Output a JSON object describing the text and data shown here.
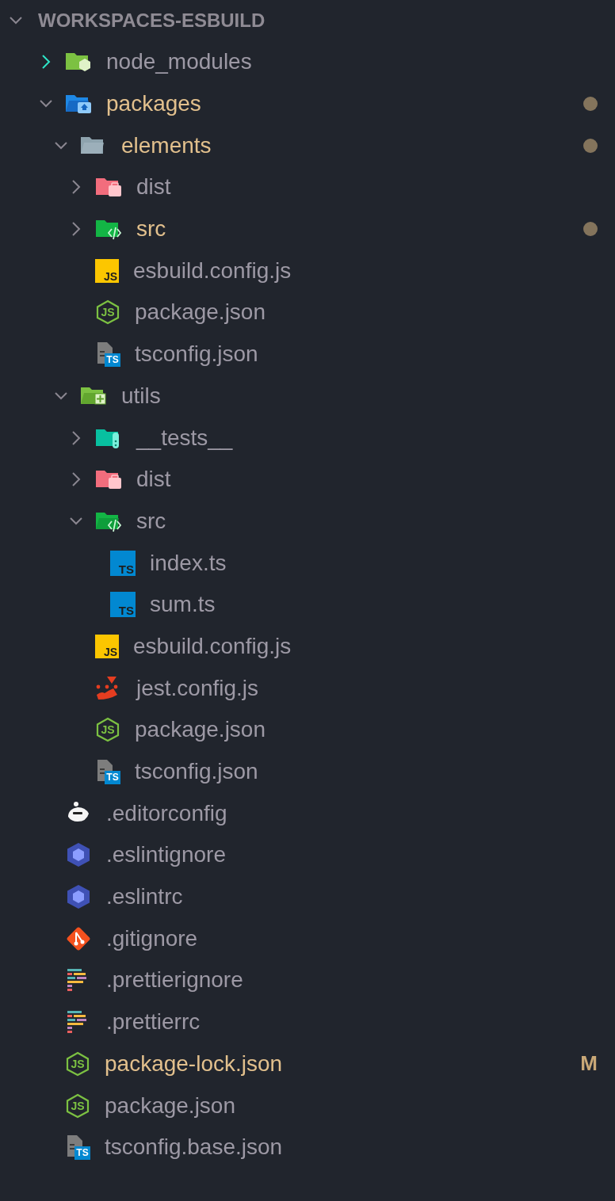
{
  "explorer": {
    "title": "WORKSPACES-ESBUILD",
    "expanded": true,
    "items": [
      {
        "name": "node_modules",
        "kind": "folder-node",
        "expanded": false,
        "selected": true,
        "modified": false,
        "dot": false
      },
      {
        "name": "packages",
        "kind": "folder-packages",
        "expanded": true,
        "selected": false,
        "modified": true,
        "dot": true,
        "children": [
          {
            "name": "elements",
            "kind": "folder-plain",
            "expanded": true,
            "selected": false,
            "modified": true,
            "dot": true,
            "children": [
              {
                "name": "dist",
                "kind": "folder-dist",
                "expanded": false,
                "selected": false,
                "modified": false,
                "dot": false
              },
              {
                "name": "src",
                "kind": "folder-src",
                "expanded": false,
                "selected": false,
                "modified": true,
                "dot": true
              },
              {
                "name": "esbuild.config.js",
                "kind": "js-file",
                "icon_label": "JS",
                "modified": false,
                "dot": false
              },
              {
                "name": "package.json",
                "kind": "node-file",
                "icon_label": "JS",
                "modified": false,
                "dot": false
              },
              {
                "name": "tsconfig.json",
                "kind": "tsconfig-file",
                "icon_label": "TS",
                "modified": false,
                "dot": false
              }
            ]
          },
          {
            "name": "utils",
            "kind": "folder-utils",
            "expanded": true,
            "selected": false,
            "modified": false,
            "dot": false,
            "children": [
              {
                "name": "__tests__",
                "kind": "folder-tests",
                "expanded": false,
                "selected": false,
                "modified": false,
                "dot": false
              },
              {
                "name": "dist",
                "kind": "folder-dist",
                "expanded": false,
                "selected": false,
                "modified": false,
                "dot": false
              },
              {
                "name": "src",
                "kind": "folder-src",
                "expanded": true,
                "selected": false,
                "modified": false,
                "dot": false,
                "children": [
                  {
                    "name": "index.ts",
                    "kind": "ts-file",
                    "icon_label": "TS",
                    "modified": false,
                    "dot": false
                  },
                  {
                    "name": "sum.ts",
                    "kind": "ts-file",
                    "icon_label": "TS",
                    "modified": false,
                    "dot": false
                  }
                ]
              },
              {
                "name": "esbuild.config.js",
                "kind": "js-file",
                "icon_label": "JS",
                "modified": false,
                "dot": false
              },
              {
                "name": "jest.config.js",
                "kind": "jest-file",
                "modified": false,
                "dot": false
              },
              {
                "name": "package.json",
                "kind": "node-file",
                "icon_label": "JS",
                "modified": false,
                "dot": false
              },
              {
                "name": "tsconfig.json",
                "kind": "tsconfig-file",
                "icon_label": "TS",
                "modified": false,
                "dot": false
              }
            ]
          }
        ]
      },
      {
        "name": ".editorconfig",
        "kind": "editorconfig-file",
        "modified": false,
        "dot": false
      },
      {
        "name": ".eslintignore",
        "kind": "eslint-file",
        "modified": false,
        "dot": false
      },
      {
        "name": ".eslintrc",
        "kind": "eslint-file",
        "modified": false,
        "dot": false
      },
      {
        "name": ".gitignore",
        "kind": "git-file",
        "modified": false,
        "dot": false
      },
      {
        "name": ".prettierignore",
        "kind": "prettier-file",
        "modified": false,
        "dot": false
      },
      {
        "name": ".prettierrc",
        "kind": "prettier-file",
        "modified": false,
        "dot": false
      },
      {
        "name": "package-lock.json",
        "kind": "node-file",
        "icon_label": "JS",
        "modified": true,
        "dot": false,
        "badge": "M"
      },
      {
        "name": "package.json",
        "kind": "node-file",
        "icon_label": "JS",
        "modified": false,
        "dot": false
      },
      {
        "name": "tsconfig.base.json",
        "kind": "tsconfig-file",
        "icon_label": "TS",
        "modified": false,
        "dot": false
      }
    ]
  }
}
